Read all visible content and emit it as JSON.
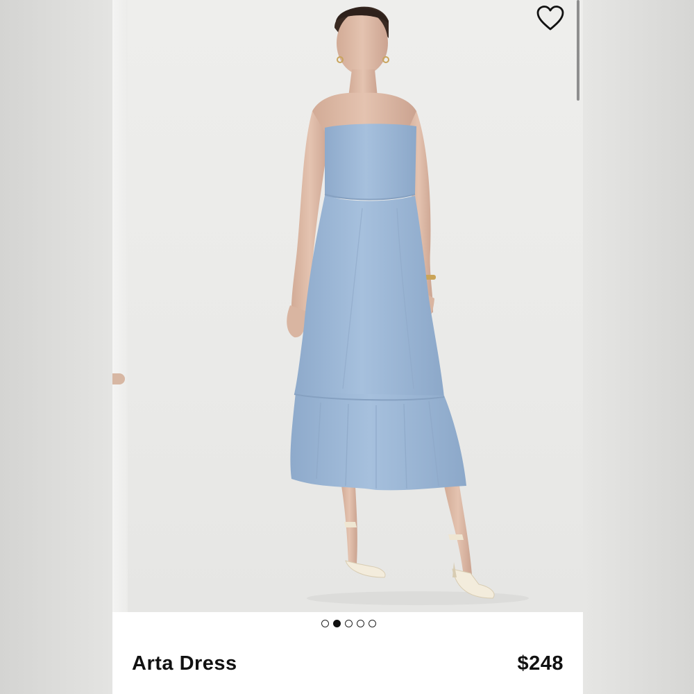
{
  "product": {
    "name": "Arta Dress",
    "price": "$248"
  },
  "gallery": {
    "total_images": 5,
    "active_index": 2
  },
  "icons": {
    "favorite": "heart-outline-icon"
  },
  "colors": {
    "dress": "#9db8d6",
    "background": "#ededeb",
    "text": "#111111"
  }
}
